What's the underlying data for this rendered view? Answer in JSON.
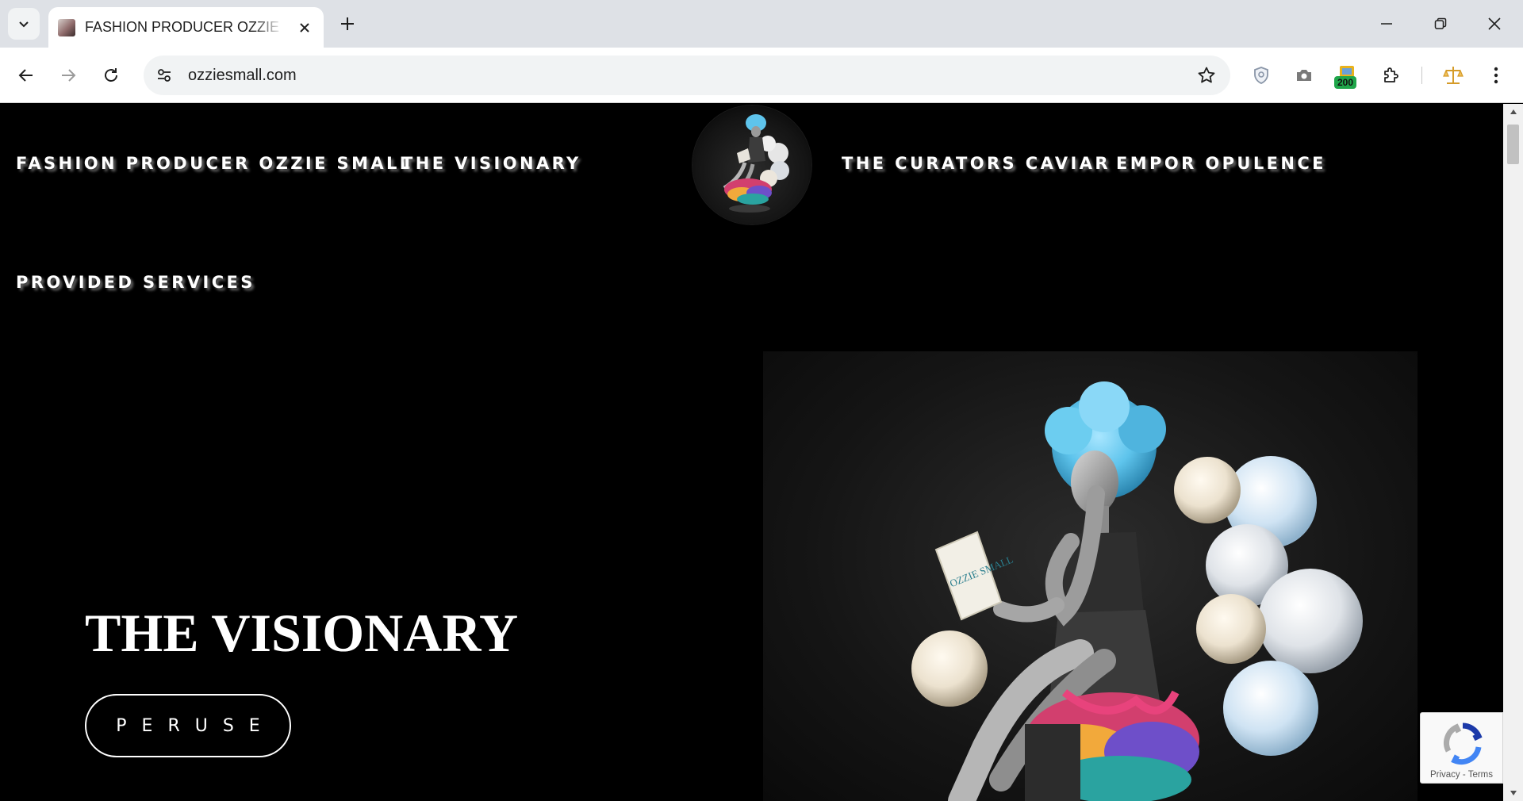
{
  "browser": {
    "tab_title": "FASHION PRODUCER OZZIE SMALL",
    "url": "ozziesmall.com",
    "extension_badge": "200"
  },
  "nav": {
    "links": [
      "FASHION PRODUCER OZZIE SMALL",
      "THE VISIONARY",
      "THE CURATORS CAVIAR",
      "EMPOR OPULENCE",
      "PROVIDED SERVICES"
    ]
  },
  "hero": {
    "title": "THE VISIONARY",
    "button_label": "PERUSE",
    "book_text": "OZZIE SMALL"
  },
  "recaptcha": {
    "privacy": "Privacy",
    "separator": " - ",
    "terms": "Terms"
  },
  "icons": {
    "tab_search": "chevron-down-icon",
    "close": "close-icon",
    "new_tab": "plus-icon",
    "back": "arrow-left-icon",
    "forward": "arrow-right-icon",
    "reload": "reload-icon",
    "site_info": "tune-icon",
    "bookmark": "star-icon",
    "shield": "shield-icon",
    "camera": "camera-icon",
    "extensions": "puzzle-icon",
    "scales": "scales-icon",
    "menu": "kebab-menu-icon"
  },
  "colors": {
    "page_background": "#000000",
    "text": "#ffffff",
    "hair_accent": "#5ec4ec",
    "badge": "#1fa64a"
  }
}
